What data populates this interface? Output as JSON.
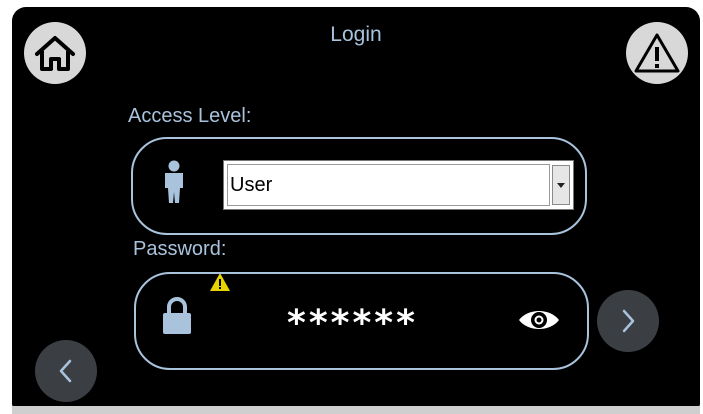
{
  "header": {
    "title": "Login"
  },
  "access": {
    "label": "Access Level:",
    "selected": "User"
  },
  "password": {
    "label": "Password:",
    "masked_value": "******"
  },
  "icons": {
    "home": "home-icon",
    "alert": "warning-icon",
    "user": "user-icon",
    "lock": "lock-icon",
    "eye": "eye-icon",
    "warning_small": "warning-icon",
    "back": "chevron-left-icon",
    "next": "chevron-right-icon"
  },
  "colors": {
    "background": "#000000",
    "accent": "#a9c3dd",
    "warning": "#e8d400",
    "button": "#3b3f44"
  }
}
